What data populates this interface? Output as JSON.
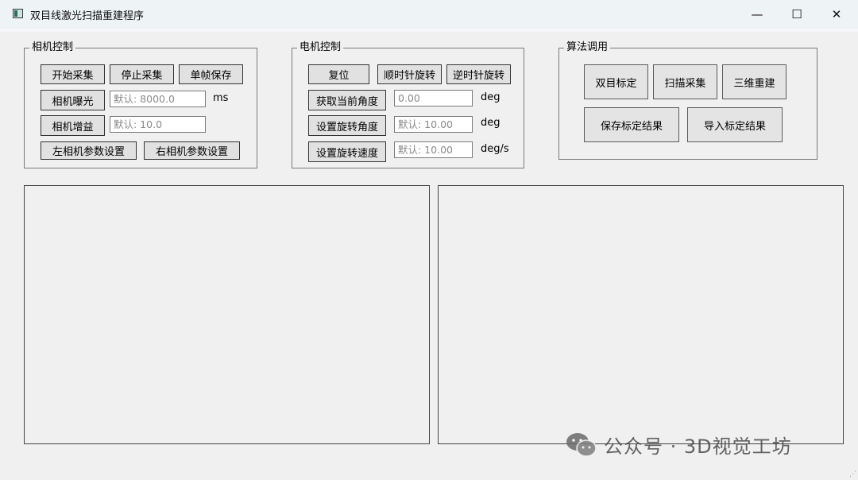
{
  "window": {
    "title": "双目线激光扫描重建程序",
    "minimize": "—",
    "maximize": "☐",
    "close": "✕"
  },
  "camera": {
    "legend": "相机控制",
    "start": "开始采集",
    "stop": "停止采集",
    "save_frame": "单帧保存",
    "exposure_label": "相机曝光",
    "exposure_placeholder": "默认: 8000.0",
    "exposure_unit": "ms",
    "gain_label": "相机增益",
    "gain_placeholder": "默认: 10.0",
    "left_params": "左相机参数设置",
    "right_params": "右相机参数设置"
  },
  "motor": {
    "legend": "电机控制",
    "reset": "复位",
    "cw": "顺时针旋转",
    "ccw": "逆时针旋转",
    "get_angle": "获取当前角度",
    "angle_value": "0.00",
    "angle_unit": "deg",
    "set_angle": "设置旋转角度",
    "set_angle_placeholder": "默认: 10.00",
    "set_angle_unit": "deg",
    "set_speed": "设置旋转速度",
    "set_speed_placeholder": "默认: 10.00",
    "speed_unit": "deg/s"
  },
  "algorithm": {
    "legend": "算法调用",
    "stereo_calib": "双目标定",
    "scan": "扫描采集",
    "reconstruct": "三维重建",
    "save_calib": "保存标定结果",
    "load_calib": "导入标定结果"
  },
  "watermark": {
    "text": "公众号 · 3D视觉工坊",
    "icon": "wechat-icon"
  }
}
